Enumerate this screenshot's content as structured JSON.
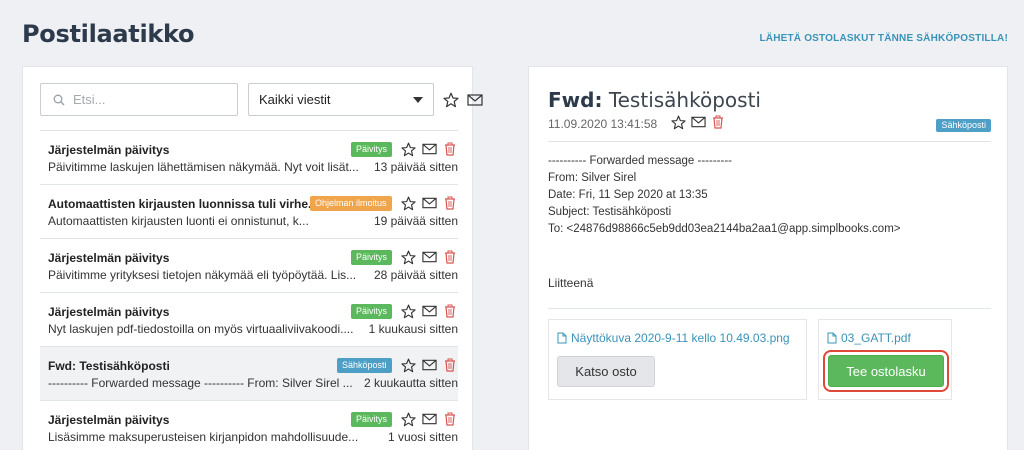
{
  "header": {
    "title": "Postilaatikko",
    "forward_link": "LÄHETÄ OSTOLASKUT TÄNNE SÄHKÖPOSTILLA!"
  },
  "toolbar": {
    "search_placeholder": "Etsi...",
    "filter_value": "Kaikki viestit"
  },
  "messages": [
    {
      "title": "Järjestelmän päivitys",
      "preview": "Päivitimme laskujen lähettämisen näkymää. Nyt voit lisät...",
      "badge": "Päivitys",
      "badge_color": "#5cb85c",
      "time": "13 päivää sitten",
      "selected": false
    },
    {
      "title": "Automaattisten kirjausten luonnissa tuli virhe.",
      "preview": "Automaattisten kirjausten luonti ei onnistunut, k...",
      "badge": "Ohjelman ilmoitus",
      "badge_color": "#f0a44b",
      "time": "19 päivää sitten",
      "selected": false
    },
    {
      "title": "Järjestelmän päivitys",
      "preview": "Päivitimme yrityksesi tietojen näkymää eli työpöytää. Lis...",
      "badge": "Päivitys",
      "badge_color": "#5cb85c",
      "time": "28 päivää sitten",
      "selected": false
    },
    {
      "title": "Järjestelmän päivitys",
      "preview": "Nyt laskujen pdf-tiedostoilla on myös virtuaaliviivakoodi....",
      "badge": "Päivitys",
      "badge_color": "#5cb85c",
      "time": "1 kuukausi sitten",
      "selected": false
    },
    {
      "title": "Fwd: Testisähköposti",
      "preview": "---------- Forwarded message ---------- From: Silver Sirel ...",
      "badge": "Sähköposti",
      "badge_color": "#4d9fc6",
      "time": "2 kuukautta sitten",
      "selected": true
    },
    {
      "title": "Järjestelmän päivitys",
      "preview": "Lisäsimme maksuperusteisen kirjanpidon mahdollisuude...",
      "badge": "Päivitys",
      "badge_color": "#5cb85c",
      "time": "1 vuosi sitten",
      "selected": false
    }
  ],
  "detail": {
    "title_prefix": "Fwd:",
    "title_rest": "Testisähköposti",
    "date": "11.09.2020 13:41:58",
    "badge": "Sähköposti",
    "body": "---------- Forwarded message ---------\nFrom: Silver Sirel\nDate: Fri, 11 Sep 2020 at 13:35\nSubject: Testisähköposti\nTo: <24876d98866c5eb9dd03ea2144ba2aa1@app.simplbooks.com>",
    "attachments_label": "Liitteenä",
    "attachments": [
      {
        "name": "Näyttökuva 2020-9-11 kello 10.49.03.png",
        "button": "Katso osto"
      },
      {
        "name": "03_GATT.pdf",
        "button": "Tee ostolasku"
      }
    ]
  },
  "colors": {
    "accent": "#3a93b8",
    "delete_icon": "#d9534f",
    "highlight": "#e0483a"
  }
}
